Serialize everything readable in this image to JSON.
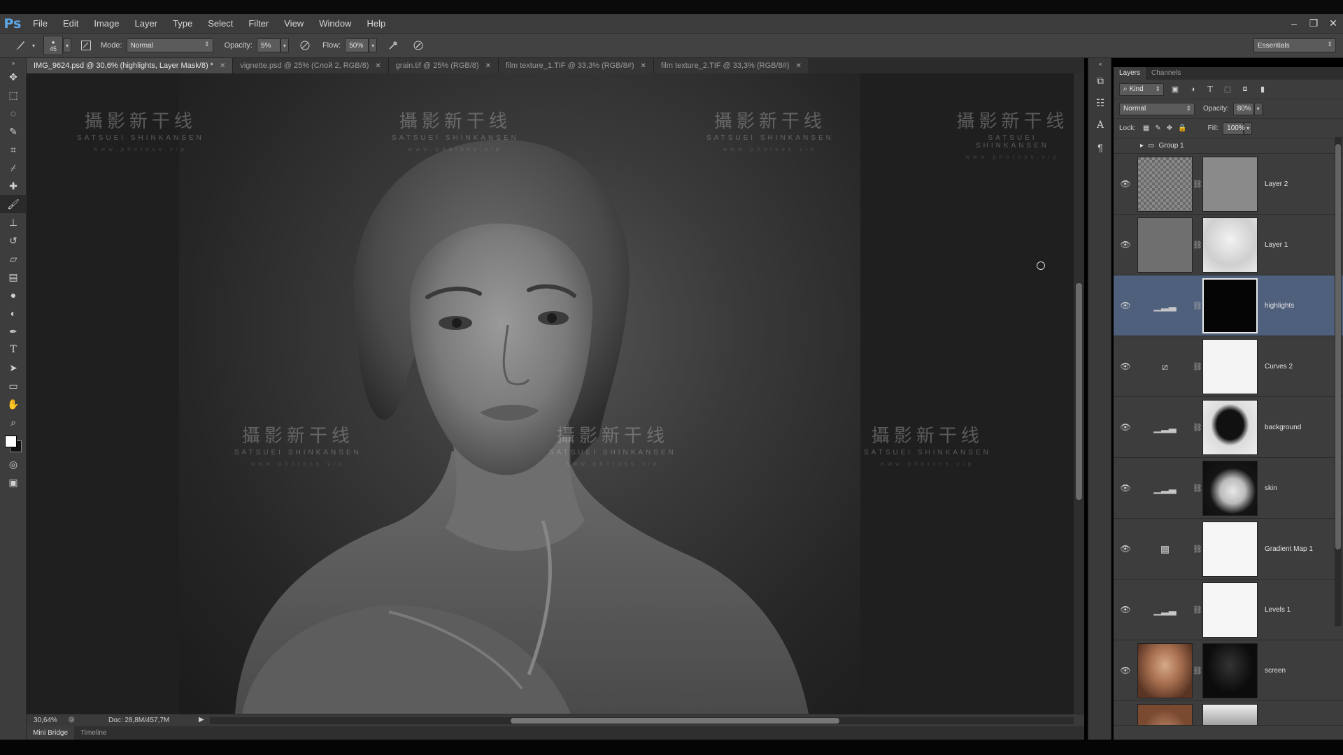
{
  "app": {
    "logo": "Ps",
    "menu": [
      "File",
      "Edit",
      "Image",
      "Layer",
      "Type",
      "Select",
      "Filter",
      "View",
      "Window",
      "Help"
    ],
    "window_controls": [
      "–",
      "❐",
      "✕"
    ]
  },
  "options_bar": {
    "brush_size": "45",
    "mode_label": "Mode:",
    "mode_value": "Normal",
    "opacity_label": "Opacity:",
    "opacity_value": "5%",
    "flow_label": "Flow:",
    "flow_value": "50%",
    "workspace": "Essentials"
  },
  "tabs": [
    {
      "label": "IMG_9624.psd @ 30,6% (highlights, Layer Mask/8) *",
      "active": true
    },
    {
      "label": "vignette.psd @ 25% (Слой 2, RGB/8)",
      "active": false
    },
    {
      "label": "grain.tif @ 25% (RGB/8)",
      "active": false
    },
    {
      "label": "film texture_1.TIF @ 33,3% (RGB/8#)",
      "active": false
    },
    {
      "label": "film texture_2.TIF @ 33,3% (RGB/8#)",
      "active": false
    }
  ],
  "watermark": {
    "cn": "攝影新干线",
    "en": "SATSUEI SHINKANSEN",
    "url": "www.photoss.vip"
  },
  "status": {
    "zoom": "30,64%",
    "doc": "Doc: 28,8M/457,7M"
  },
  "bottom_tabs": [
    "Mini Bridge",
    "Timeline"
  ],
  "layers_panel": {
    "tabs": [
      "Layers",
      "Channels"
    ],
    "filter_kind": "Kind",
    "blend_mode": "Normal",
    "opacity_label": "Opacity:",
    "opacity_value": "80%",
    "lock_label": "Lock:",
    "fill_label": "Fill:",
    "fill_value": "100%",
    "group_name": "Group 1",
    "layers": [
      {
        "name": "Layer 2",
        "kind": "pixel-mask",
        "thumb": "#7d7d7d",
        "mask": "#8a8a8a",
        "selected": false
      },
      {
        "name": "Layer 1",
        "kind": "pixel-mask",
        "thumb": "#6f6f6f",
        "mask": "#d9d9d9",
        "selected": false
      },
      {
        "name": "highlights",
        "kind": "levels",
        "mask": "#050505",
        "selected": true
      },
      {
        "name": "Curves 2",
        "kind": "curves",
        "mask": "#f4f4f4",
        "selected": false
      },
      {
        "name": "background",
        "kind": "levels",
        "mask": "#1a1a1a",
        "selected": false
      },
      {
        "name": "skin",
        "kind": "levels",
        "mask": "#151515",
        "selected": false
      },
      {
        "name": "Gradient Map 1",
        "kind": "gradient",
        "mask": "#f6f6f6",
        "selected": false
      },
      {
        "name": "Levels 1",
        "kind": "levels",
        "mask": "#f6f6f6",
        "selected": false
      },
      {
        "name": "screen",
        "kind": "pixel-mask",
        "thumb": "#8a5a3c",
        "mask": "#0c0c0c",
        "selected": false
      }
    ]
  }
}
